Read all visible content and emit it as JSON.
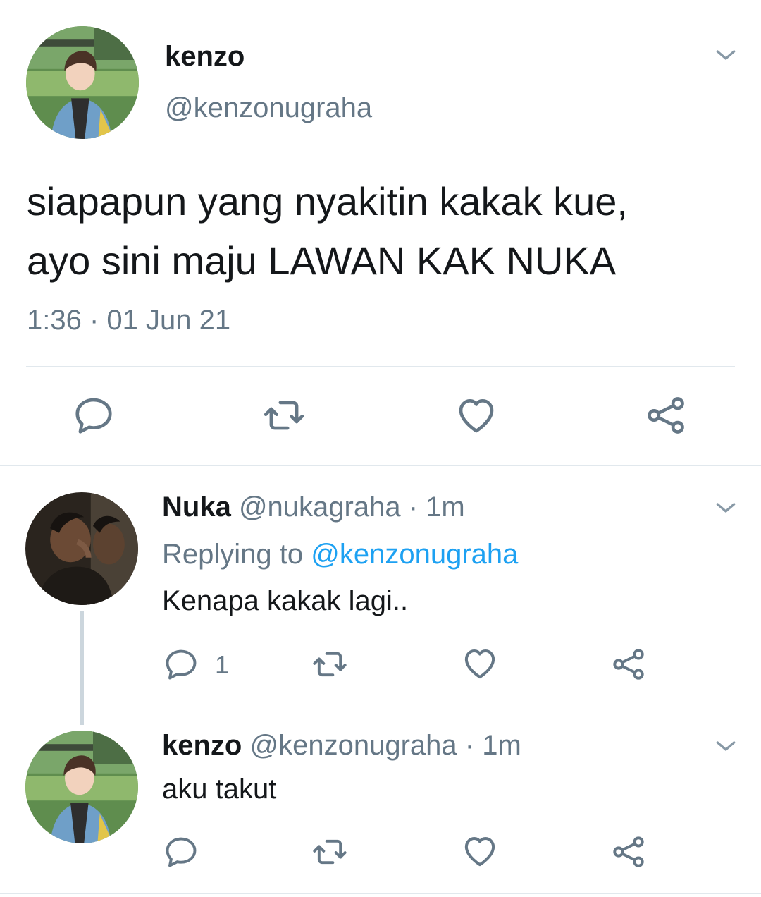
{
  "main_tweet": {
    "display_name": "kenzo",
    "handle": "@kenzonugraha",
    "text_line1": "siapapun yang nyakitin kakak kue,",
    "text_line2": "ayo sini maju LAWAN KAK NUKA",
    "timestamp": "1:36 · 01 Jun 21",
    "actions": [
      "reply-icon",
      "retweet-icon",
      "like-icon",
      "share-icon"
    ]
  },
  "replies": [
    {
      "display_name": "Nuka",
      "handle": "@nukagraha",
      "separator": "·",
      "time": "1m",
      "replying_prefix": "Replying to ",
      "replying_to": "@kenzonugraha",
      "text": "Kenapa kakak lagi..",
      "reply_count": "1"
    },
    {
      "display_name": "kenzo",
      "handle": "@kenzonugraha",
      "separator": "·",
      "time": "1m",
      "text": "aku takut",
      "reply_count": ""
    }
  ],
  "colors": {
    "text": "#14171a",
    "secondary": "#657786",
    "link": "#1da1f2",
    "icon": "#657786",
    "divider": "#e1e8ed",
    "thread_line": "#ccd6dd"
  }
}
